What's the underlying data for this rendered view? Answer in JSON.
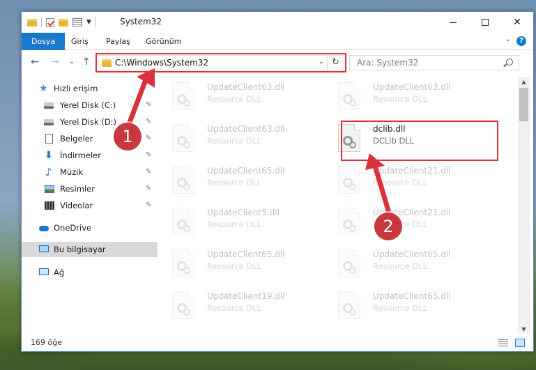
{
  "window": {
    "title": "System32",
    "minimize_label": "—",
    "close_label": "✕"
  },
  "ribbon": {
    "tabs": [
      {
        "label": "Dosya",
        "active": true
      },
      {
        "label": "Giriş",
        "active": false
      },
      {
        "label": "Paylaş",
        "active": false
      },
      {
        "label": "Görünüm",
        "active": false
      }
    ],
    "help_label": "?"
  },
  "address_bar": {
    "path": "C:\\Windows\\System32",
    "search_placeholder": "Ara: System32"
  },
  "nav_buttons": {
    "back": "←",
    "forward": "→",
    "recent": "⌄",
    "up": "↑"
  },
  "nav_pane": {
    "items": [
      {
        "label": "Hızlı erişim",
        "icon": "star-icon",
        "pinned": false
      },
      {
        "label": "Yerel Disk (C:)",
        "icon": "drive-icon",
        "pinned": true
      },
      {
        "label": "Yerel Disk (D:)",
        "icon": "drive-icon",
        "pinned": true
      },
      {
        "label": "Belgeler",
        "icon": "document-icon",
        "pinned": true
      },
      {
        "label": "İndirmeler",
        "icon": "download-icon",
        "pinned": true
      },
      {
        "label": "Müzik",
        "icon": "music-icon",
        "pinned": true
      },
      {
        "label": "Resimler",
        "icon": "pictures-icon",
        "pinned": true
      },
      {
        "label": "Videolar",
        "icon": "video-icon",
        "pinned": true
      },
      {
        "label": "OneDrive",
        "icon": "cloud-icon",
        "pinned": false
      },
      {
        "label": "Bu bilgisayar",
        "icon": "computer-icon",
        "pinned": false,
        "selected": true
      },
      {
        "label": "Ağ",
        "icon": "network-icon",
        "pinned": false
      }
    ],
    "pin_glyph": "📌"
  },
  "files": [
    {
      "name": "UpdateClient63.dll",
      "type": "Resource DLL",
      "highlight": false
    },
    {
      "name": "UpdateClient63.dll",
      "type": "Resource DLL",
      "highlight": false
    },
    {
      "name": "UpdateClient63.dll",
      "type": "Resource DLL",
      "highlight": false
    },
    {
      "name": "dclib.dll",
      "type": "DCLib DLL",
      "highlight": true
    },
    {
      "name": "UpdateClient65.dll",
      "type": "Resource DLL",
      "highlight": false
    },
    {
      "name": "UpdateClient21.dll",
      "type": "Resource DLL",
      "highlight": false
    },
    {
      "name": "UpdateClient5.dll",
      "type": "Resource DLL",
      "highlight": false
    },
    {
      "name": "UpdateClient21.dll",
      "type": "Resource DLL",
      "highlight": false
    },
    {
      "name": "UpdateClient65.dll",
      "type": "Resource DLL",
      "highlight": false
    },
    {
      "name": "UpdateClient65.dll",
      "type": "Resource DLL",
      "highlight": false
    },
    {
      "name": "UpdateClient19.dll",
      "type": "Resource DLL",
      "highlight": false
    },
    {
      "name": "UpdateClient65.dll",
      "type": "Resource DLL",
      "highlight": false
    }
  ],
  "status": {
    "item_count": "169 öğe"
  },
  "annotations": {
    "step1": "1",
    "step2": "2"
  },
  "colors": {
    "accent": "#1979ca",
    "annotation_red": "#d9323a",
    "selection": "#d9d9d9"
  }
}
